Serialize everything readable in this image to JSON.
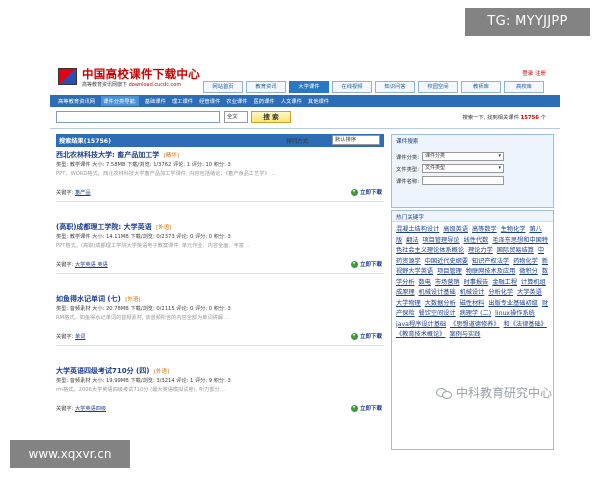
{
  "overlays": {
    "tg": "TG: MYYJJPP",
    "www": "www.xqxvr.cn",
    "watermark": "中科教育研究中心"
  },
  "header": {
    "title": "中国高校课件下载中心",
    "subtitle": "高等教育资讯网旗下",
    "url": "download.cucdc.com",
    "top_links": "登录 注册",
    "nav_tabs": [
      {
        "label": "网站首页",
        "active": false
      },
      {
        "label": "教育资讯",
        "active": false
      },
      {
        "label": "大学课件",
        "active": true
      },
      {
        "label": "在线视频",
        "active": false
      },
      {
        "label": "知识问答",
        "active": false
      },
      {
        "label": "校园空间",
        "active": false
      },
      {
        "label": "教师库",
        "active": false
      },
      {
        "label": "高校库",
        "active": false
      }
    ]
  },
  "category_bar": [
    "高等教育资讯网",
    "课件分类导航:",
    "基础课件",
    "理工课件",
    "经管课件",
    "农业课件",
    "医药课件",
    "人文课件",
    "其他课件"
  ],
  "search": {
    "scope": "全文",
    "button": "搜 索",
    "result_prefix": "搜索一下, 找到相关课件",
    "result_count": "15756",
    "result_suffix": "个"
  },
  "results_header": {
    "title": "搜索结果(15756)",
    "sort_label": "排列方式:",
    "sort_value": "默认排序"
  },
  "results": [
    {
      "title": "西北农林科技大学: 畜产品加工学",
      "tag": "[精华]",
      "meta": "类型: 教学课件  大小: 7.58MB  下载/浏览: 1/3762  评论: 1  评分: 10  积分: 3",
      "desc": "PPT、WORD格式。西北农林科技大学畜产品加工学课件, 内容包括绪论、《畜产食品工艺学》 ...",
      "kw_label": "关键字:",
      "kw": "畜产品",
      "download": "立即下载"
    },
    {
      "title": "(高职)成都理工学院: 大学英语",
      "tag": "[外语]",
      "meta": "类型: 教学课件  大小: 14.11MB  下载/浏览: 0/2373  评论: 0  评分: 0  积分: 3",
      "desc": "PPT格式。(高职)成都理工学院大学英语电子教案课件, 单元作业、内容全面、丰富 ...",
      "kw_label": "关键字:",
      "kw": "大学英语 英语",
      "download": "立即下载"
    },
    {
      "title": "如鱼得水记单词 (七)",
      "tag": "[外语]",
      "meta": "类型: 音频素材  大小: 20.78MB  下载/浏览: 0/2115  评论: 0  评分: 0  积分: 3",
      "desc": "RM格式。如鱼得水记单词的音频素材, 该音频所含的内容全部为单词讲解 ...",
      "kw_label": "关键字:",
      "kw": "单词",
      "download": "立即下载"
    },
    {
      "title": "大学英语四级考试710分 (四)",
      "tag": "[外语]",
      "meta": "类型: 音频素材  大小: 19.99MB  下载/浏览: 3/3214  评论: 1  评分: 9  积分: 3",
      "desc": "rm格式。2006大学英语四级考试710分 (最大英语模拟试卷), 听力部分 ...",
      "kw_label": "关键字:",
      "kw": "大学英语四级",
      "download": "立即下载"
    }
  ],
  "side_search": {
    "title": "课件搜索",
    "rows": [
      {
        "label": "课件分类:",
        "value": "课件分类"
      },
      {
        "label": "文件类型:",
        "value": "文件类型"
      },
      {
        "label": "课件名称:",
        "value": ""
      }
    ]
  },
  "hot_keywords": {
    "title": "热门关键字",
    "items": [
      "混凝土结构设计",
      "高级英语",
      "高等数学",
      "生物化学",
      "第八版",
      "翻法",
      "项目管理导论",
      "线性代数",
      "毛泽东思想和中国特色社会主义理论体系概论",
      "理论力学",
      "国际贸易结算",
      "中药资源学",
      "中国近代史纲要",
      "知识产权法学",
      "药物化学",
      "新视野大学英语",
      "项目管理",
      "物联网技术及应用",
      "微积分",
      "数学分析",
      "数电",
      "市场营销",
      "时事报告",
      "金融工程",
      "计算机组成原理",
      "机械设计基础",
      "机械设计",
      "分析化学",
      "大学英语",
      "大学物理",
      "大数据分析",
      "磁性材料",
      "出版专业基础初级",
      "财产保险",
      "餐饮空间设计",
      "病理学 (二)",
      "linux操作系统",
      "java程序设计基础",
      "《思想道德修养》",
      "和《法律基础》",
      "《教育技术概论》",
      "案例与实践"
    ]
  }
}
